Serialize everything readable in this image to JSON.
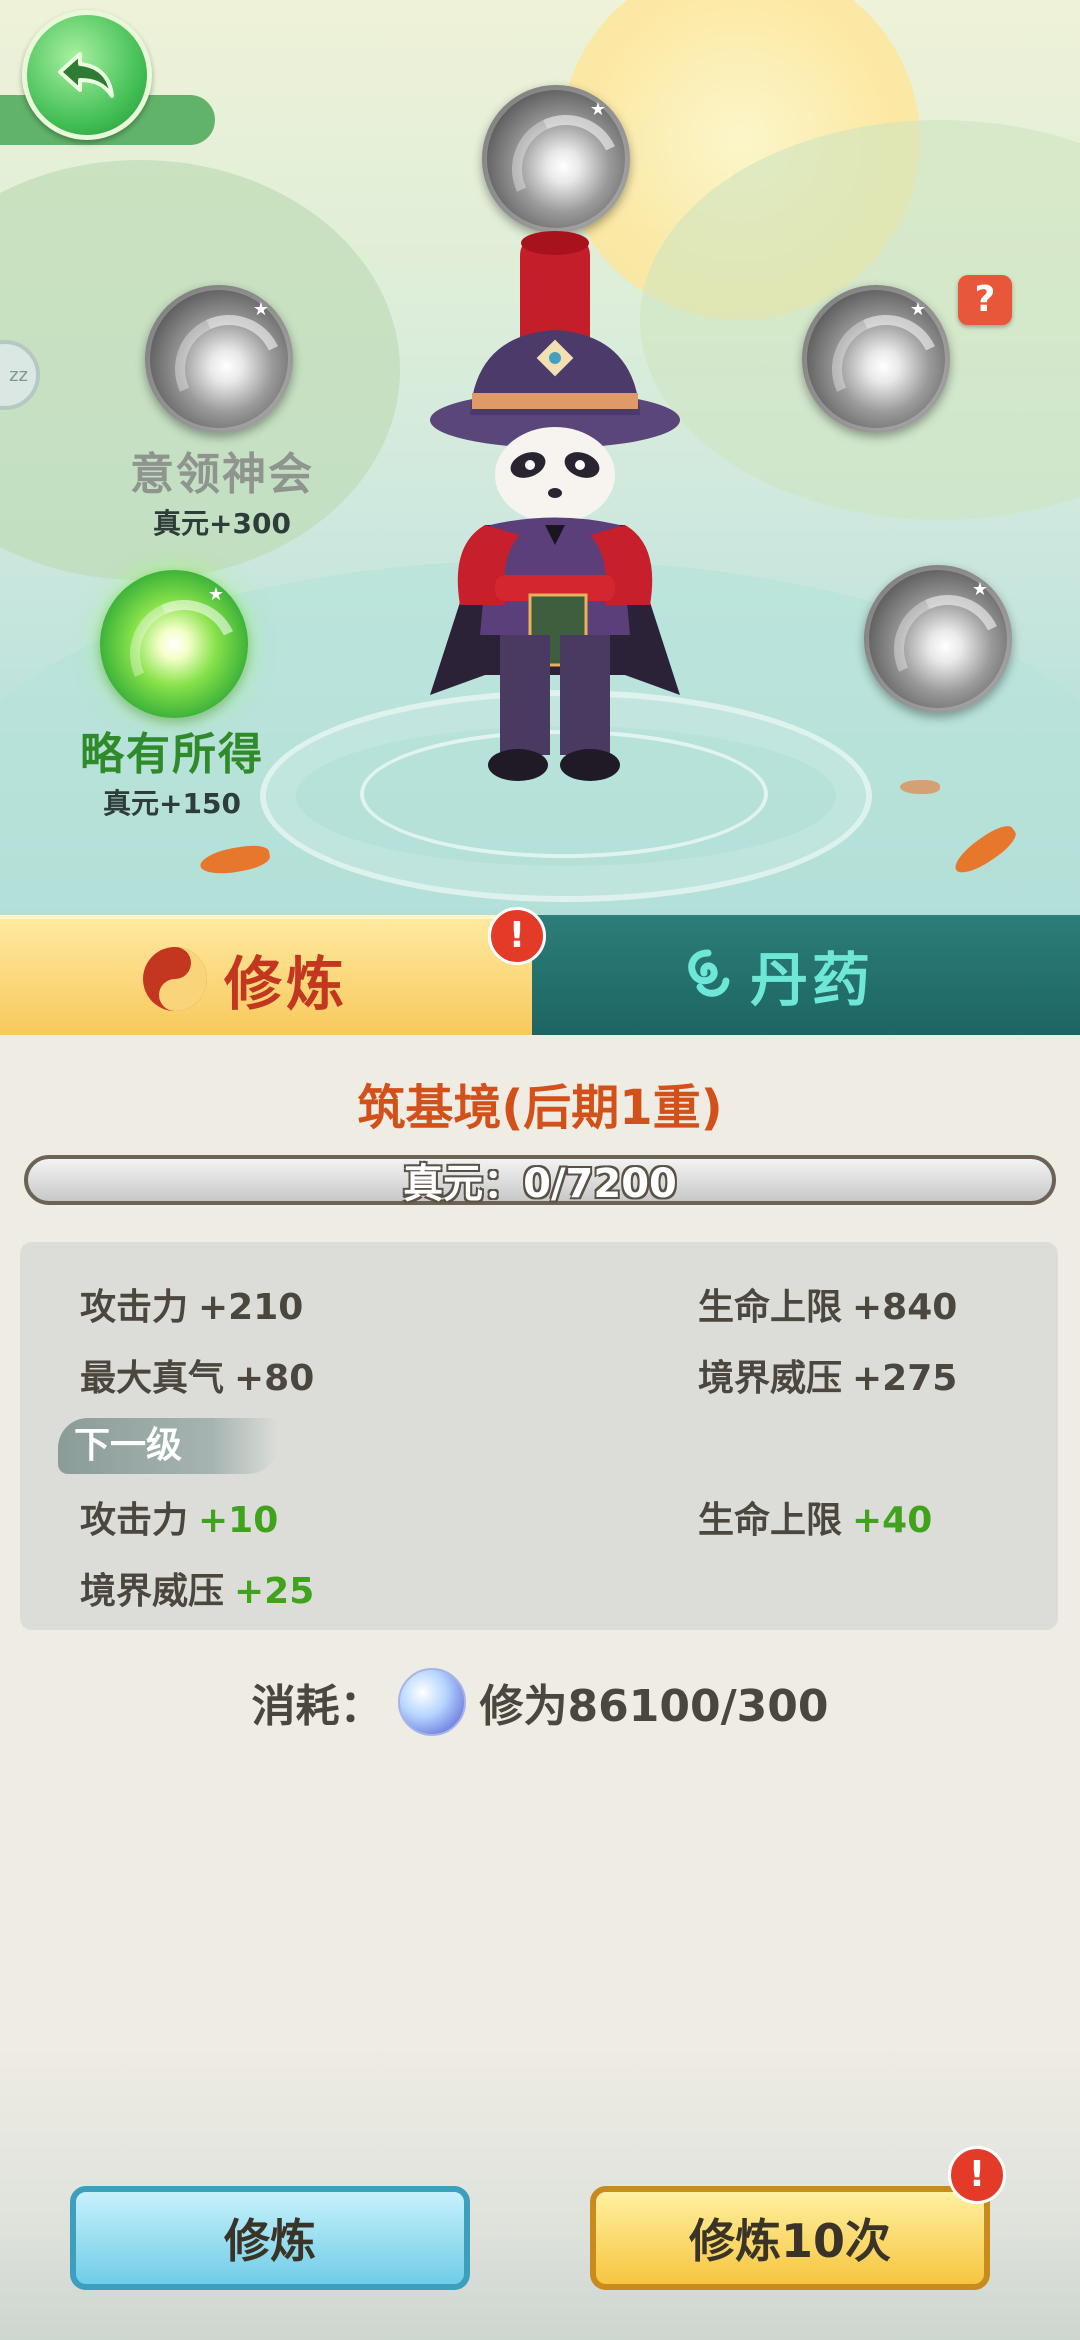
{
  "scene": {
    "orbs": [
      {
        "name": "意领神会",
        "bonus": "真元+300",
        "state": "inactive"
      },
      {
        "name": "略有所得",
        "bonus": "真元+150",
        "state": "active"
      }
    ],
    "help_label": "?"
  },
  "tabs": [
    {
      "label": "修炼",
      "selected": true,
      "icon": "yin-yang-icon",
      "badge": "!"
    },
    {
      "label": "丹药",
      "selected": false,
      "icon": "swirl-icon"
    }
  ],
  "cultivation": {
    "realm": "筑基境(后期1重)",
    "progress_text": "真元：0/7200",
    "progress_fraction": 0
  },
  "stats": {
    "current": [
      {
        "label": "攻击力",
        "value": "+210"
      },
      {
        "label": "生命上限",
        "value": "+840"
      },
      {
        "label": "最大真气",
        "value": "+80"
      },
      {
        "label": "境界威压",
        "value": "+275"
      }
    ],
    "next_level_label": "下一级",
    "next": [
      {
        "label": "攻击力",
        "value": "+10"
      },
      {
        "label": "生命上限",
        "value": "+40"
      },
      {
        "label": "境界威压",
        "value": "+25"
      }
    ]
  },
  "cost": {
    "label": "消耗：",
    "value": "修为86100/300"
  },
  "buttons": {
    "cultivate": "修炼",
    "cultivate_10": "修炼10次",
    "badge": "!"
  },
  "colors": {
    "accent_orange": "#d2511a",
    "green_value": "#3fa31c",
    "tab_gold": "#f8c95c",
    "tab_teal": "#1d6562"
  }
}
